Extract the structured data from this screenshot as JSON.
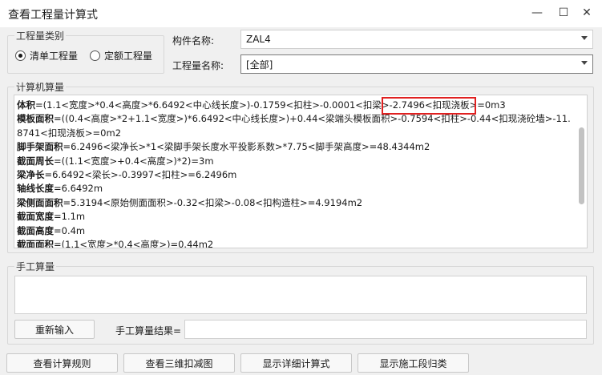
{
  "window": {
    "title": "查看工程量计算式",
    "minimize": "—",
    "maximize": "☐",
    "close": "✕"
  },
  "quantity_type": {
    "legend": "工程量类别",
    "options": [
      {
        "label": "清单工程量",
        "checked": true
      },
      {
        "label": "定额工程量",
        "checked": false
      }
    ]
  },
  "component_name": {
    "label": "构件名称:",
    "value": "ZAL4"
  },
  "quantity_name": {
    "label": "工程量名称:",
    "value": "[全部]"
  },
  "computer_calc": {
    "legend": "计算机算量",
    "lines": [
      {
        "name": "体积",
        "expr": "=(1.1<宽度>*0.4<高度>*6.6492<中心线长度>)-0.1759<扣柱>-0.0001<扣梁>-2.7496<扣现浇板>=0m3"
      },
      {
        "name": "模板面积",
        "expr": "=((0.4<高度>*2+1.1<宽度>)*6.6492<中心线长度>)+0.44<梁端头模板面积>-0.7594<扣柱>-0.44<扣现浇砼墙>-11."
      },
      {
        "name": "",
        "expr": "8741<扣现浇板>=0m2"
      },
      {
        "name": "脚手架面积",
        "expr": "=6.2496<梁净长>*1<梁脚手架长度水平投影系数>*7.75<脚手架高度>=48.4344m2"
      },
      {
        "name": "截面周长",
        "expr": "=((1.1<宽度>+0.4<高度>)*2)=3m"
      },
      {
        "name": "梁净长",
        "expr": "=6.6492<梁长>-0.3997<扣柱>=6.2496m"
      },
      {
        "name": "轴线长度",
        "expr": "=6.6492m"
      },
      {
        "name": "梁侧面面积",
        "expr": "=5.3194<原始侧面面积>-0.32<扣梁>-0.08<扣构造柱>=4.9194m2"
      },
      {
        "name": "截面宽度",
        "expr": "=1.1m"
      },
      {
        "name": "截面高度",
        "expr": "=0.4m"
      },
      {
        "name": "截面面积",
        "expr": "=(1.1<宽度>*0.4<高度>)=0.44m2"
      }
    ],
    "highlight_color": "#e02020"
  },
  "manual_calc": {
    "legend": "手工算量",
    "reinput_button": "重新输入",
    "result_label": "手工算量结果="
  },
  "footer_buttons": [
    "查看计算规则",
    "查看三维扣减图",
    "显示详细计算式",
    "显示施工段归类"
  ]
}
